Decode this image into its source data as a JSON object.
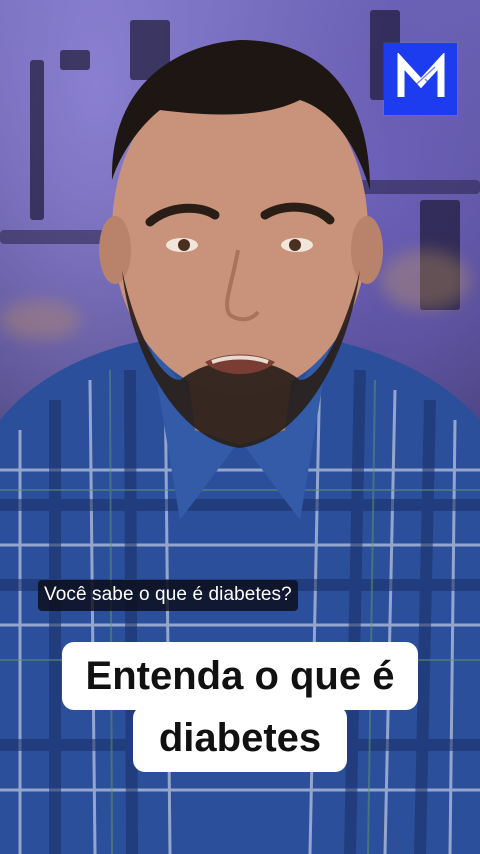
{
  "brand": {
    "logo_letter": "M",
    "logo_color": "#1d3cf0"
  },
  "subtitle": {
    "text": "Você sabe o que é diabetes?"
  },
  "headline": {
    "line1": "Entenda o que é",
    "line2": "diabetes"
  }
}
